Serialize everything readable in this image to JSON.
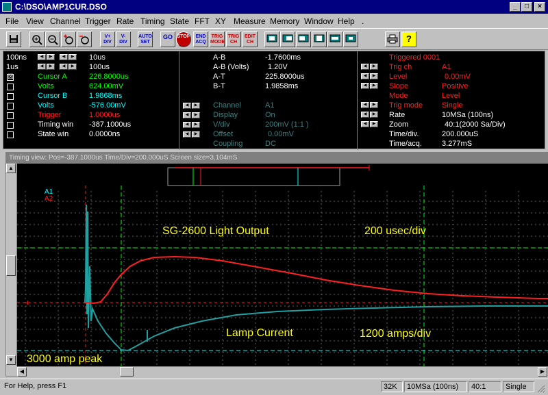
{
  "window": {
    "title": "C:\\DSO\\AMP1CUR.DSO",
    "minimize": "_",
    "maximize": "□",
    "close": "×"
  },
  "menu": [
    "File",
    "View",
    "Channel",
    "Trigger",
    "Rate",
    "Timing",
    "State",
    "FFT",
    "XY",
    "Measure",
    "Memory",
    "Window",
    "Help",
    "."
  ],
  "toolbar": [
    {
      "name": "save-button",
      "label": "",
      "icon": "floppy-icon"
    },
    {
      "name": "zoom-in-button",
      "label": "",
      "icon": "zoom-in-icon"
    },
    {
      "name": "zoom-out-button",
      "label": "",
      "icon": "zoom-out-icon"
    },
    {
      "name": "zoom-cursor-plus-button",
      "label": "",
      "icon": "zoom-plus-icon"
    },
    {
      "name": "zoom-cursor-minus-button",
      "label": "",
      "icon": "zoom-minus-icon"
    },
    {
      "name": "volts-per-div-up-button",
      "label": "V+ DIV",
      "icon": ""
    },
    {
      "name": "volts-per-div-down-button",
      "label": "V- DIV",
      "icon": ""
    },
    {
      "name": "auto-set-button",
      "label": "AUTO SET",
      "icon": ""
    },
    {
      "name": "go-button",
      "label": "GO",
      "icon": ""
    },
    {
      "name": "stop-button",
      "label": "STOP",
      "icon": ""
    },
    {
      "name": "end-acq-button",
      "label": "END ACQ",
      "icon": ""
    },
    {
      "name": "trig-mode-button",
      "label": "TRIG MODE",
      "icon": ""
    },
    {
      "name": "trig-ch-button",
      "label": "TRIG CH",
      "icon": ""
    },
    {
      "name": "edit-ch-button",
      "label": "EDIT CH",
      "icon": ""
    },
    {
      "name": "view-1-button",
      "label": "",
      "icon": "view-icon"
    },
    {
      "name": "view-2-button",
      "label": "",
      "icon": "view-icon"
    },
    {
      "name": "view-3-button",
      "label": "",
      "icon": "view-icon"
    },
    {
      "name": "view-4-button",
      "label": "",
      "icon": "view-icon"
    },
    {
      "name": "view-5-button",
      "label": "",
      "icon": "view-icon"
    },
    {
      "name": "view-6-button",
      "label": "",
      "icon": "view-icon"
    },
    {
      "name": "print-button",
      "label": "",
      "icon": "printer-icon"
    },
    {
      "name": "help-button",
      "label": "?",
      "icon": "help-icon"
    }
  ],
  "left_panel": {
    "time1_label": "100ns",
    "time1_value": "10us",
    "time2_label": "1us",
    "time2_value": "100us",
    "rows": [
      {
        "label": "Cursor A",
        "value": "226.8000us",
        "color": "#00ff00",
        "checked": "☒"
      },
      {
        "label": "Volts",
        "value": "624.00mV",
        "color": "#00ff00",
        "checked": ""
      },
      {
        "label": "Cursor B",
        "value": "1.9868ms",
        "color": "#00ffff",
        "checked": ""
      },
      {
        "label": "Volts",
        "value": "-576.00mV",
        "color": "#00ffff",
        "checked": ""
      },
      {
        "label": "Trigger",
        "value": "1.0000us",
        "color": "#ff2020",
        "checked": ""
      },
      {
        "label": "Timing win",
        "value": "-387.1000us",
        "color": "#ffffff",
        "checked": ""
      },
      {
        "label": "State win",
        "value": "0.0000ns",
        "color": "#ffffff",
        "checked": ""
      }
    ]
  },
  "middle_panel": {
    "measurements": [
      {
        "label": "A-B",
        "value": "-1.7600ms"
      },
      {
        "label": "A-B (Volts)",
        "value": "1.20V"
      },
      {
        "label": "A-T",
        "value": "225.8000us"
      },
      {
        "label": "B-T",
        "value": "1.9858ms"
      }
    ],
    "channel_rows": [
      {
        "label": "Channel",
        "value": "A1"
      },
      {
        "label": "Display",
        "value": "On"
      },
      {
        "label": "V/div",
        "value": "200mV (1:1   )"
      },
      {
        "label": "Offset",
        "value": "0.00mV"
      },
      {
        "label": "Coupling",
        "value": "DC"
      }
    ]
  },
  "right_panel": {
    "status": "Triggered 0001",
    "trigger_rows": [
      {
        "label": "Trig ch",
        "value": "A1"
      },
      {
        "label": "Level",
        "value": "0.00mV"
      },
      {
        "label": "Slope",
        "value": "Positive"
      },
      {
        "label": "Mode",
        "value": "Level"
      },
      {
        "label": "Trig mode",
        "value": "Single"
      }
    ],
    "rate_rows": [
      {
        "label": "Rate",
        "value": "10MSa (100ns)"
      },
      {
        "label": "Zoom",
        "value": "40:1(2000 Sa/Div)"
      },
      {
        "label": "Time/div.",
        "value": "200.000uS"
      },
      {
        "label": "Time/acq.",
        "value": "3.277mS"
      }
    ]
  },
  "scope": {
    "header": "Timing view: Pos=-387.1000us Time/Div=200.000uS Screen size=3.104mS",
    "channel_a1": "A1",
    "channel_a2": "A2",
    "annotations": {
      "light_output": "SG-2600 Light Output",
      "time_div": "200 usec/div",
      "lamp_current": "Lamp Current",
      "amps_div": "1200 amps/div",
      "peak": "3000 amp peak"
    },
    "colors": {
      "light_trace": "#ff2020",
      "current_trace": "#20a0a0",
      "grid": "#606060",
      "cursor_a": "#00ff00",
      "cursor_b": "#00ffff",
      "annotation": "#ffff00"
    }
  },
  "statusbar": {
    "help": "For Help, press F1",
    "memory": "32K",
    "rate": "10MSa (100ns)",
    "zoom": "40:1",
    "mode": "Single"
  }
}
